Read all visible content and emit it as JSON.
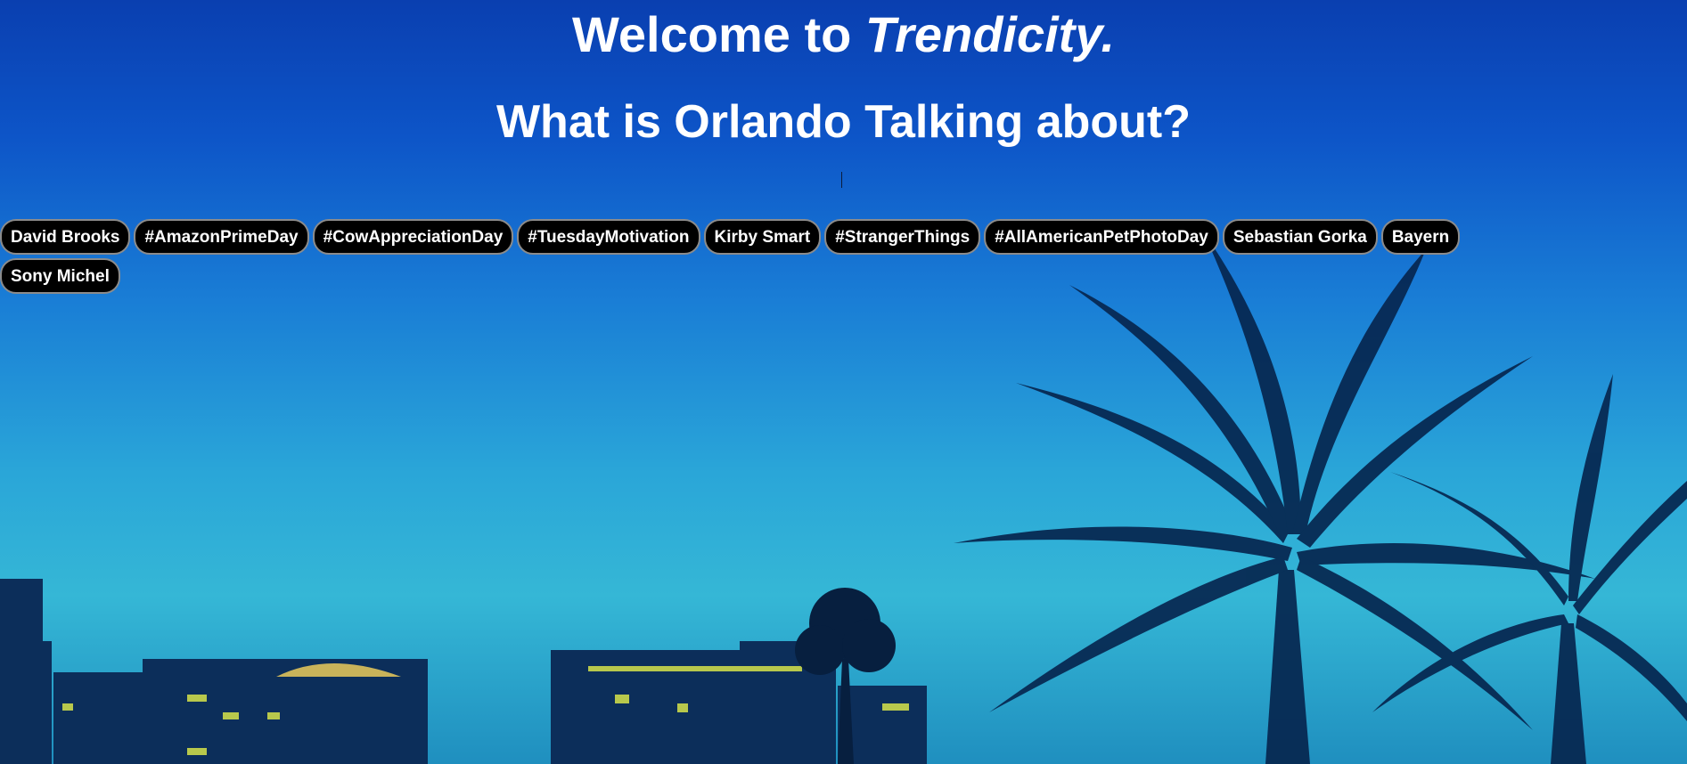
{
  "header": {
    "welcome_prefix": "Welcome to ",
    "brand": "Trendicity.",
    "subtitle": "What is Orlando Talking about?"
  },
  "trends": [
    "David Brooks",
    "#AmazonPrimeDay",
    "#CowAppreciationDay",
    "#TuesdayMotivation",
    "Kirby Smart",
    "#StrangerThings",
    "#AllAmericanPetPhotoDay",
    "Sebastian Gorka",
    "Bayern",
    "Sony Michel"
  ],
  "colors": {
    "sky_top": "#0a3fb0",
    "sky_bottom": "#35b7d6",
    "tag_bg": "#000000",
    "tag_border": "#8b8b8b",
    "text": "#ffffff"
  }
}
